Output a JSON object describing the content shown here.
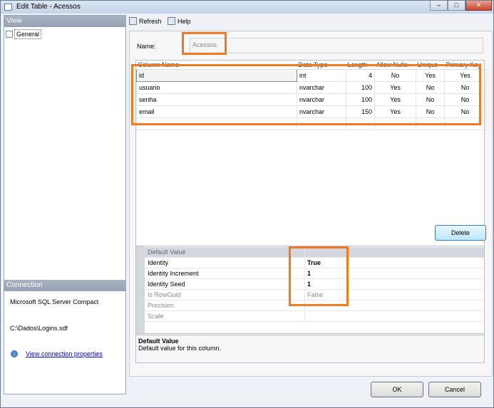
{
  "window": {
    "title": "Edit Table - Acessos",
    "minimize": "–",
    "maximize": "□",
    "close": "✕"
  },
  "left": {
    "view_header": "View",
    "general_item": "General",
    "connection_header": "Connection",
    "provider": "Microsoft SQL Server Compact",
    "file_path": "C:\\Dados\\Logins.sdf",
    "view_link": "View connection properties"
  },
  "toolbar": {
    "refresh": "Refresh",
    "help": "Help"
  },
  "main": {
    "name_label": "Name:",
    "name_value": "Acessos",
    "columns": [
      "Column Name",
      "Data Type",
      "Length",
      "Allow Nulls",
      "Unique",
      "Primary Key"
    ],
    "rows": [
      [
        "id",
        "int",
        "4",
        "No",
        "Yes",
        "Yes"
      ],
      [
        "usuario",
        "nvarchar",
        "100",
        "Yes",
        "No",
        "No"
      ],
      [
        "senha",
        "nvarchar",
        "100",
        "Yes",
        "No",
        "No"
      ],
      [
        "email",
        "nvarchar",
        "150",
        "Yes",
        "No",
        "No"
      ],
      [
        "",
        "",
        "",
        "",
        "",
        ""
      ]
    ],
    "delete_label": "Delete"
  },
  "properties": [
    {
      "name": "Default Value",
      "value": ""
    },
    {
      "name": "Identity",
      "value": "True"
    },
    {
      "name": "Identity Increment",
      "value": "1"
    },
    {
      "name": "Identity Seed",
      "value": "1"
    },
    {
      "name": "Is RowGuid",
      "value": "False"
    },
    {
      "name": "Precision",
      "value": ""
    },
    {
      "name": "Scale",
      "value": ""
    }
  ],
  "description": {
    "title": "Default Value",
    "text": "Default value for this column."
  },
  "buttons": {
    "ok": "OK",
    "cancel": "Cancel"
  },
  "colors": {
    "highlight": "#f07a23",
    "link": "#0000d0"
  }
}
